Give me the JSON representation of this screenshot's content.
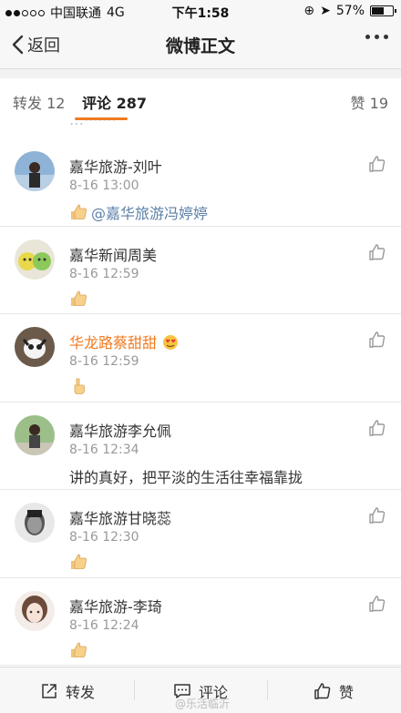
{
  "status_bar": {
    "carrier": "中国联通",
    "network": "4G",
    "time": "下午1:58",
    "battery_percent": "57%",
    "battery_level": 0.57
  },
  "nav": {
    "back_label": "返回",
    "title": "微博正文"
  },
  "tabs": {
    "repost": "转发 12",
    "comments": "评论 287",
    "likes": "赞 19"
  },
  "comments": [
    {
      "name": "嘉华旅游-刘叶",
      "time": "8-16 13:00",
      "mention": "@嘉华旅游冯婷婷"
    },
    {
      "name": "嘉华新闻周美",
      "time": "8-16 12:59"
    },
    {
      "name": "华龙路蔡甜甜",
      "time": "8-16 12:59"
    },
    {
      "name": "嘉华旅游李允佩",
      "time": "8-16 12:34",
      "text": "讲的真好，把平淡的生活往幸福靠拢"
    },
    {
      "name": "嘉华旅游甘晓蕊",
      "time": "8-16 12:30"
    },
    {
      "name": "嘉华旅游-李琦",
      "time": "8-16 12:24"
    }
  ],
  "bottom_bar": {
    "repost": "转发",
    "comment": "评论",
    "like": "赞"
  },
  "watermark": "@乐活临沂",
  "icons": [
    "chevron-left-icon",
    "more-icon",
    "thumbs-up-icon",
    "share-icon",
    "comment-icon",
    "like-icon"
  ],
  "colors": {
    "accent": "#f07b21",
    "link": "#5b7fa8"
  }
}
